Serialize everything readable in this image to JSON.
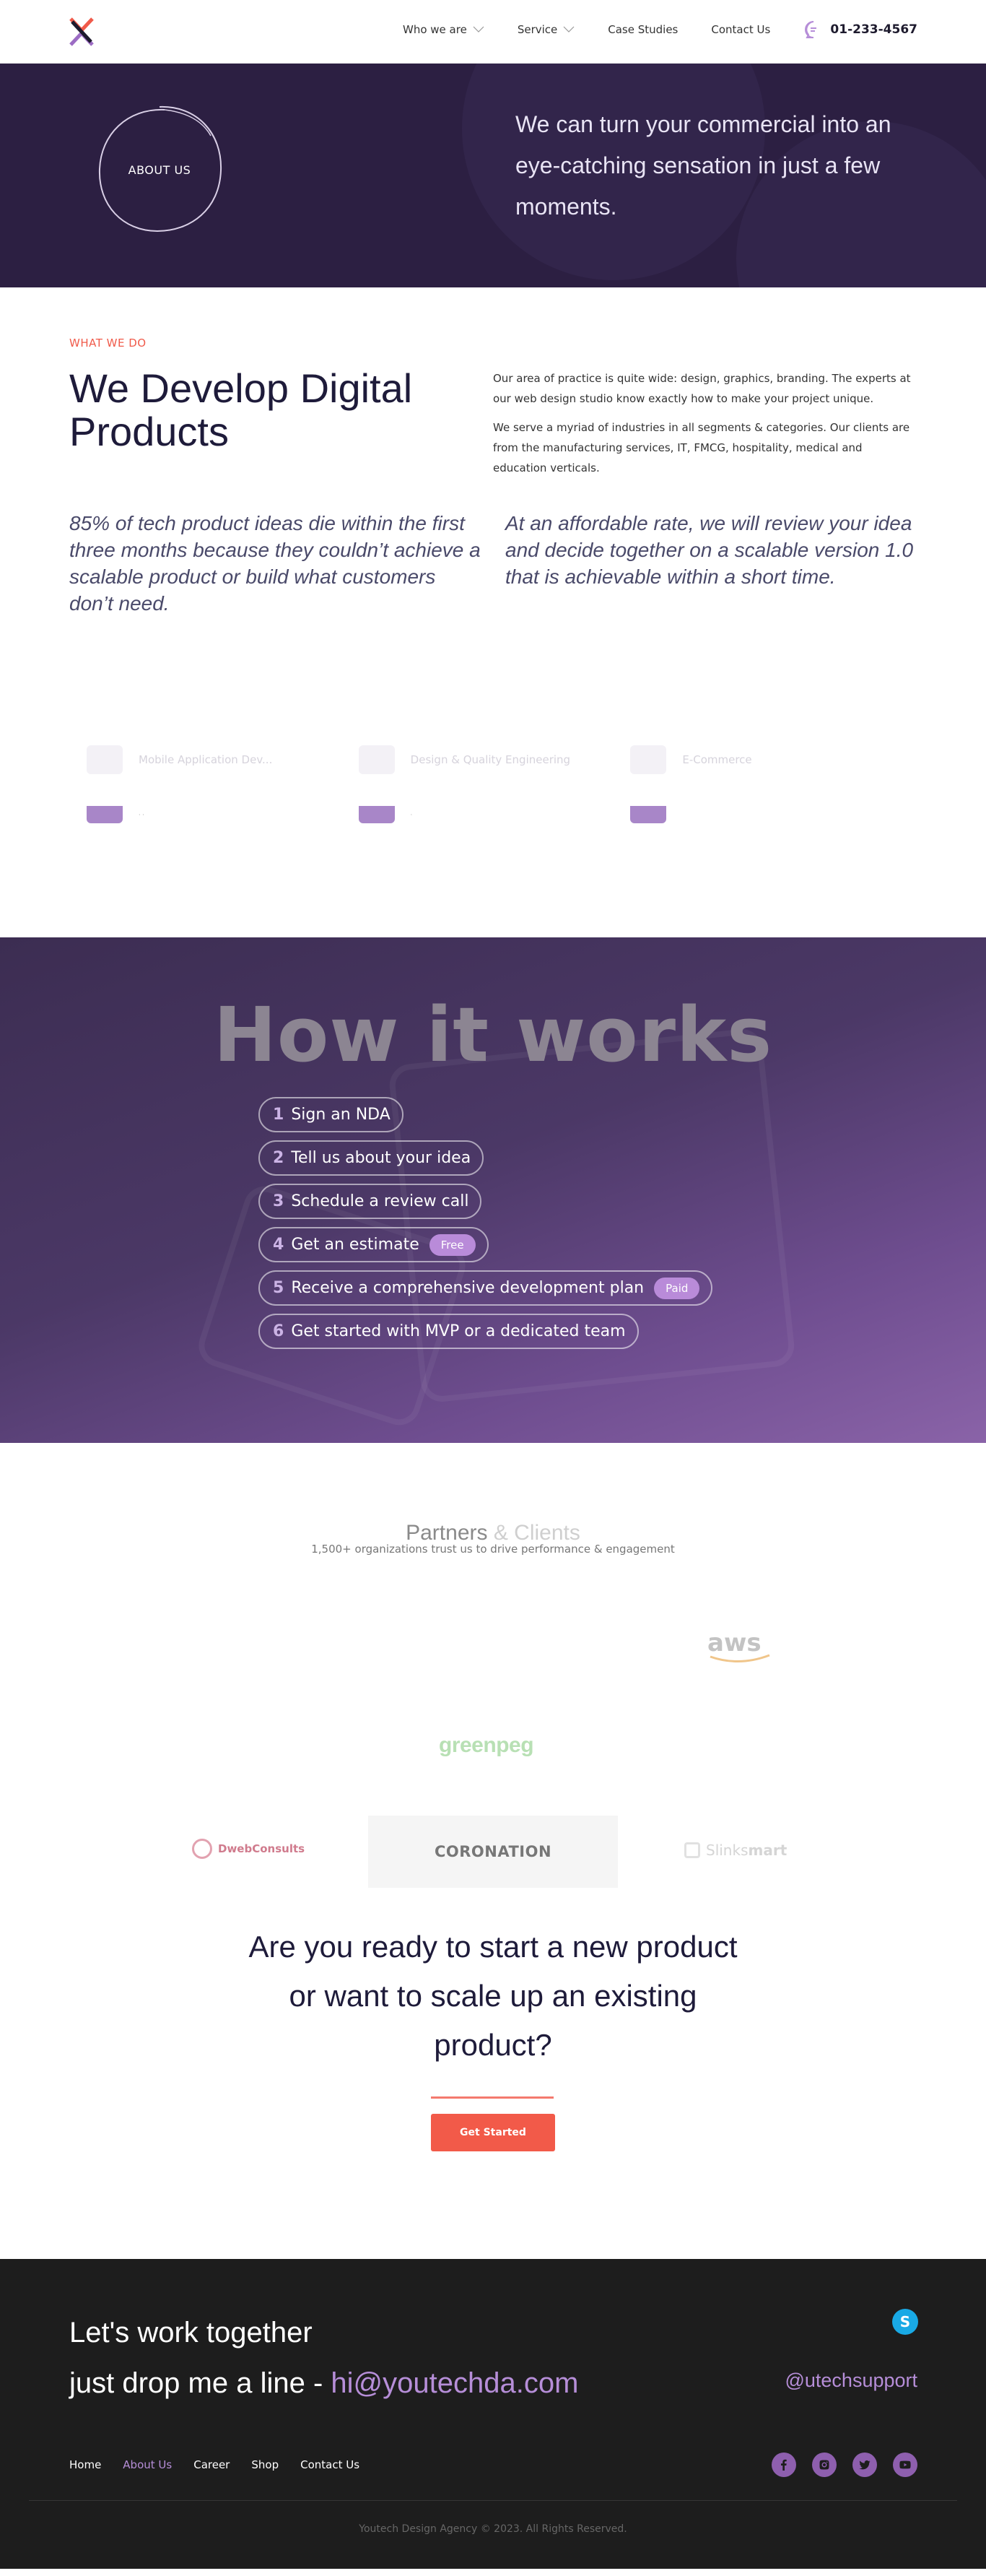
{
  "brand": {
    "accent": "#f05a4a",
    "purple": "#b68ed8",
    "dark": "#2c1f42",
    "logo_icon": "x-arrows-logo"
  },
  "header": {
    "nav": [
      {
        "label": "Who we are",
        "has_dropdown": true
      },
      {
        "label": "Service",
        "has_dropdown": true
      },
      {
        "label": "Case Studies",
        "has_dropdown": false
      },
      {
        "label": "Contact Us",
        "has_dropdown": false
      }
    ],
    "phone_icon": "chat-bubble-icon",
    "phone": "01-233-4567"
  },
  "about_hero": {
    "badge": "ABOUT US",
    "tagline": "We can turn your commercial into an eye-catching sensation in just a few moments."
  },
  "what_we_do": {
    "eyebrow": "WHAT WE DO",
    "title": "We Develop Digital Products",
    "body_1": "Our area of practice is quite wide: design, graphics, branding. The experts at our web design studio know exactly how to make your project unique.",
    "body_2": "We serve a myriad of industries in all segments & categories. Our clients are from the manufacturing services, IT, FMCG, hospitality, medical and education verticals.",
    "quote_1": "85% of tech product ideas die within the first three months because they couldn’t achieve a scalable product or build what customers don’t need.",
    "quote_2": "At an affordable rate, we will review your idea and decide together on a scalable version 1.0 that is achievable within a short time.",
    "services": [
      {
        "label": "Mobile Application Dev..."
      },
      {
        "label": "Design & Quality Engineering"
      },
      {
        "label": "E-Commerce"
      }
    ],
    "services_row2": [
      {
        "label": "· ·"
      },
      {
        "label": "·"
      },
      {
        "label": ""
      }
    ]
  },
  "how_it_works": {
    "title": "How it works",
    "steps": [
      {
        "num": "1",
        "label": "Sign an NDA",
        "tag": ""
      },
      {
        "num": "2",
        "label": "Tell us about your idea",
        "tag": ""
      },
      {
        "num": "3",
        "label": "Schedule a review call",
        "tag": ""
      },
      {
        "num": "4",
        "label": "Get an estimate",
        "tag": "Free"
      },
      {
        "num": "5",
        "label": "Receive a comprehensive development plan",
        "tag": "Paid"
      },
      {
        "num": "6",
        "label": "Get started with MVP or a dedicated team",
        "tag": ""
      }
    ]
  },
  "partners": {
    "title_main": "Partners",
    "title_amp": " & Clients",
    "subtitle": "1,500+ organizations trust us to drive performance & engagement",
    "logos": {
      "aws": "aws",
      "greenpeg": "greenpeg",
      "dweb": "DwebConsults",
      "coronation": "CORONATION",
      "slinks_a": "Slinks",
      "slinks_b": "mart"
    }
  },
  "cta": {
    "title": "Are you ready to start a new product or want to scale up an existing product?",
    "button": "Get Started"
  },
  "footer": {
    "line_1": "Let's work together",
    "line_2_prefix": "just drop me a line - ",
    "email": "hi@youtechda.com",
    "skype_icon": "skype-icon",
    "handle": "@utechsupport",
    "links": [
      {
        "label": "Home",
        "active": false
      },
      {
        "label": "About Us",
        "active": true
      },
      {
        "label": "Career",
        "active": false
      },
      {
        "label": "Shop",
        "active": false
      },
      {
        "label": "Contact Us",
        "active": false
      }
    ],
    "social": [
      "facebook-icon",
      "instagram-icon",
      "twitter-icon",
      "youtube-icon"
    ],
    "copyright": "Youtech Design Agency © 2023. All Rights Reserved."
  }
}
